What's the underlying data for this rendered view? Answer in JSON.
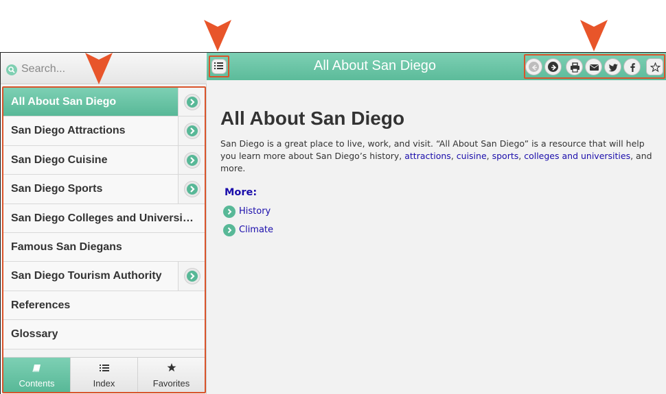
{
  "search": {
    "placeholder": "Search..."
  },
  "nav": {
    "items": [
      {
        "label": "All About San Diego",
        "active": true,
        "expandable": true
      },
      {
        "label": "San Diego Attractions",
        "active": false,
        "expandable": true
      },
      {
        "label": "San Diego Cuisine",
        "active": false,
        "expandable": true
      },
      {
        "label": "San Diego Sports",
        "active": false,
        "expandable": true
      },
      {
        "label": "San Diego Colleges and Universities",
        "active": false,
        "expandable": false
      },
      {
        "label": "Famous San Diegans",
        "active": false,
        "expandable": false
      },
      {
        "label": "San Diego Tourism Authority",
        "active": false,
        "expandable": true
      },
      {
        "label": "References",
        "active": false,
        "expandable": false
      },
      {
        "label": "Glossary",
        "active": false,
        "expandable": false
      }
    ]
  },
  "tabs": [
    {
      "label": "Contents",
      "icon": "book-icon",
      "active": true
    },
    {
      "label": "Index",
      "icon": "list-icon",
      "active": false
    },
    {
      "label": "Favorites",
      "icon": "star-icon",
      "active": false
    }
  ],
  "header": {
    "title": "All About San Diego"
  },
  "toolbar": {
    "buttons": [
      "previous-topic",
      "next-topic",
      "print",
      "email",
      "twitter",
      "facebook",
      "add-favorite"
    ]
  },
  "content": {
    "title": "All About San Diego",
    "paragraph": {
      "intro": "San Diego is a great place to live, work, and visit. “All About San Diego” is a resource that will help you learn more about San Diego’s history, ",
      "link_attractions": "attractions",
      "sep1": ", ",
      "link_cuisine": "cuisine",
      "sep2": ", ",
      "link_sports": "sports",
      "sep3": ", ",
      "link_colleges": "colleges and universities",
      "outro": ", and more."
    },
    "more_heading": "More:",
    "more_links": [
      "History",
      "Climate"
    ]
  },
  "colors": {
    "accent": "#58b897",
    "callout": "#e8552a",
    "link": "#1a0dab"
  }
}
